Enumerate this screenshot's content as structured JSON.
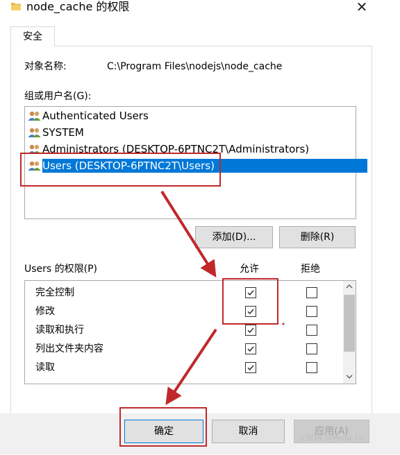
{
  "window": {
    "title": "node_cache 的权限",
    "close_symbol": "✕"
  },
  "tabs": [
    {
      "label": "安全",
      "active": true
    }
  ],
  "object": {
    "label": "对象名称:",
    "value": "C:\\Program Files\\nodejs\\node_cache"
  },
  "groups": {
    "label": "组或用户名(G):",
    "items": [
      {
        "label": "Authenticated Users",
        "icon": "users-icon",
        "selected": false
      },
      {
        "label": "SYSTEM",
        "icon": "users-icon",
        "selected": false
      },
      {
        "label": "Administrators (DESKTOP-6PTNC2T\\Administrators)",
        "icon": "users-icon",
        "selected": false
      },
      {
        "label": "Users (DESKTOP-6PTNC2T\\Users)",
        "icon": "users-icon",
        "selected": true
      }
    ],
    "add_label": "添加(D)...",
    "remove_label": "删除(R)"
  },
  "permissions": {
    "label": "Users 的权限(P)",
    "allow_header": "允许",
    "deny_header": "拒绝",
    "rows": [
      {
        "name": "完全控制",
        "allow": true,
        "deny": false
      },
      {
        "name": "修改",
        "allow": true,
        "deny": false
      },
      {
        "name": "读取和执行",
        "allow": true,
        "deny": false
      },
      {
        "name": "列出文件夹内容",
        "allow": true,
        "deny": false
      },
      {
        "name": "读取",
        "allow": true,
        "deny": false
      }
    ]
  },
  "footer": {
    "ok_label": "确定",
    "cancel_label": "取消",
    "apply_label": "应用(A)"
  },
  "watermark": "CSDN @Peng_Lu_",
  "colors": {
    "selection": "#0078d7",
    "annotation_red": "#c0282a",
    "button_face": "#e1e1e1"
  }
}
